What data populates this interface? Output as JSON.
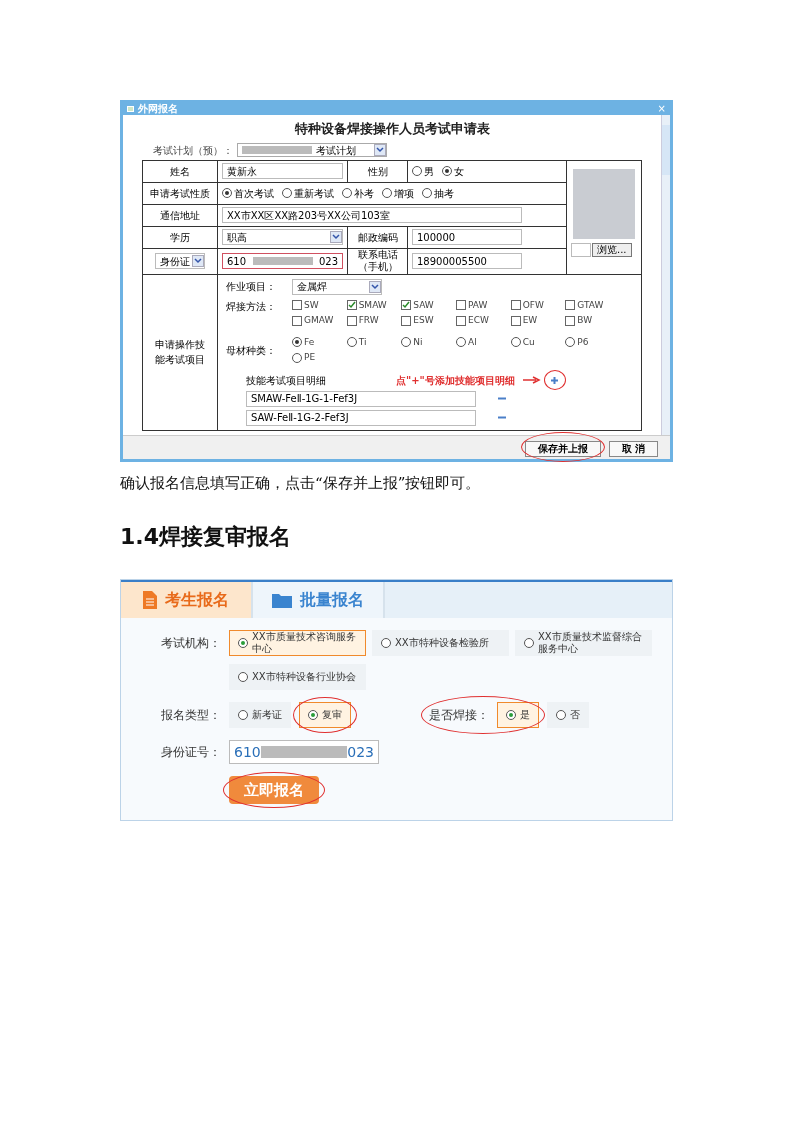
{
  "dialog": {
    "title": "外网报名",
    "close": "×",
    "form_title": "特种设备焊接操作人员考试申请表",
    "plan_label": "考试计划（预）：",
    "plan_value": "考试计划",
    "name_label": "姓名",
    "name_value": "黄新永",
    "gender_label": "性别",
    "gender_options": [
      {
        "label": "男",
        "selected": false
      },
      {
        "label": "女",
        "selected": true
      }
    ],
    "exam_type_label": "申请考试性质",
    "exam_types": [
      {
        "label": "首次考试",
        "selected": true
      },
      {
        "label": "重新考试",
        "selected": false
      },
      {
        "label": "补考",
        "selected": false
      },
      {
        "label": "增项",
        "selected": false
      },
      {
        "label": "抽考",
        "selected": false
      }
    ],
    "address_label": "通信地址",
    "address_value": "XX市XX区XX路203号XX公司103室",
    "education_label": "学历",
    "education_value": "职高",
    "postcode_label": "邮政编码",
    "postcode_value": "100000",
    "id_type": "身份证",
    "id_prefix": "610",
    "id_suffix": "023",
    "phone_label": "联系电话（手机）",
    "phone_value": "18900005500",
    "browse_button": "浏览...",
    "skill_label": "申请操作技能考试项目",
    "work_item_label": "作业项目：",
    "work_item_value": "金属焊",
    "method_label": "焊接方法：",
    "methods": [
      {
        "label": "SW",
        "checked": false
      },
      {
        "label": "SMAW",
        "checked": true
      },
      {
        "label": "SAW",
        "checked": true
      },
      {
        "label": "PAW",
        "checked": false
      },
      {
        "label": "OFW",
        "checked": false
      },
      {
        "label": "GTAW",
        "checked": false
      },
      {
        "label": "GMAW",
        "checked": false
      },
      {
        "label": "FRW",
        "checked": false
      },
      {
        "label": "ESW",
        "checked": false
      },
      {
        "label": "ECW",
        "checked": false
      },
      {
        "label": "EW",
        "checked": false
      },
      {
        "label": "BW",
        "checked": false
      }
    ],
    "material_label": "母材种类：",
    "materials": [
      {
        "label": "Fe",
        "selected": true
      },
      {
        "label": "Ti",
        "selected": false
      },
      {
        "label": "Ni",
        "selected": false
      },
      {
        "label": "Al",
        "selected": false
      },
      {
        "label": "Cu",
        "selected": false
      },
      {
        "label": "P6",
        "selected": false
      },
      {
        "label": "PE",
        "selected": false
      }
    ],
    "detail_label": "技能考试项目明细",
    "annotation": "点\"+\"号添加技能项目明细",
    "add_circled": true,
    "details": [
      "SMAW-FeⅡ-1G-1-Fef3J",
      "SAW-FeⅡ-1G-2-Fef3J"
    ],
    "buttons": [
      {
        "label": "保存并上报",
        "circled": true
      },
      {
        "label": "取 消",
        "circled": false
      }
    ]
  },
  "caption": "确认报名信息填写正确，点击“保存并上报”按钮即可。",
  "heading": "1.4焊接复审报名",
  "panel": {
    "tabs": [
      {
        "label": "考生报名",
        "selected": true
      },
      {
        "label": "批量报名",
        "selected": false
      }
    ],
    "org_label": "考试机构：",
    "orgs": [
      {
        "label": "XX市质量技术咨询服务中心",
        "selected": true
      },
      {
        "label": "XX市特种设备检验所",
        "selected": false
      },
      {
        "label": "XX市质量技术监督综合服务中心",
        "selected": false
      },
      {
        "label": "XX市特种设备行业协会",
        "selected": false
      }
    ],
    "type_label": "报名类型：",
    "types": [
      {
        "label": "新考证",
        "selected": false,
        "circled": false
      },
      {
        "label": "复审",
        "selected": true,
        "circled": true
      }
    ],
    "weld_label": "是否焊接：",
    "weld_circled": true,
    "weld_options": [
      {
        "label": "是",
        "selected": true
      },
      {
        "label": "否",
        "selected": false
      }
    ],
    "id_label": "身份证号：",
    "id_prefix": "610",
    "id_suffix": "023",
    "submit": "立即报名",
    "submit_circled": true
  }
}
